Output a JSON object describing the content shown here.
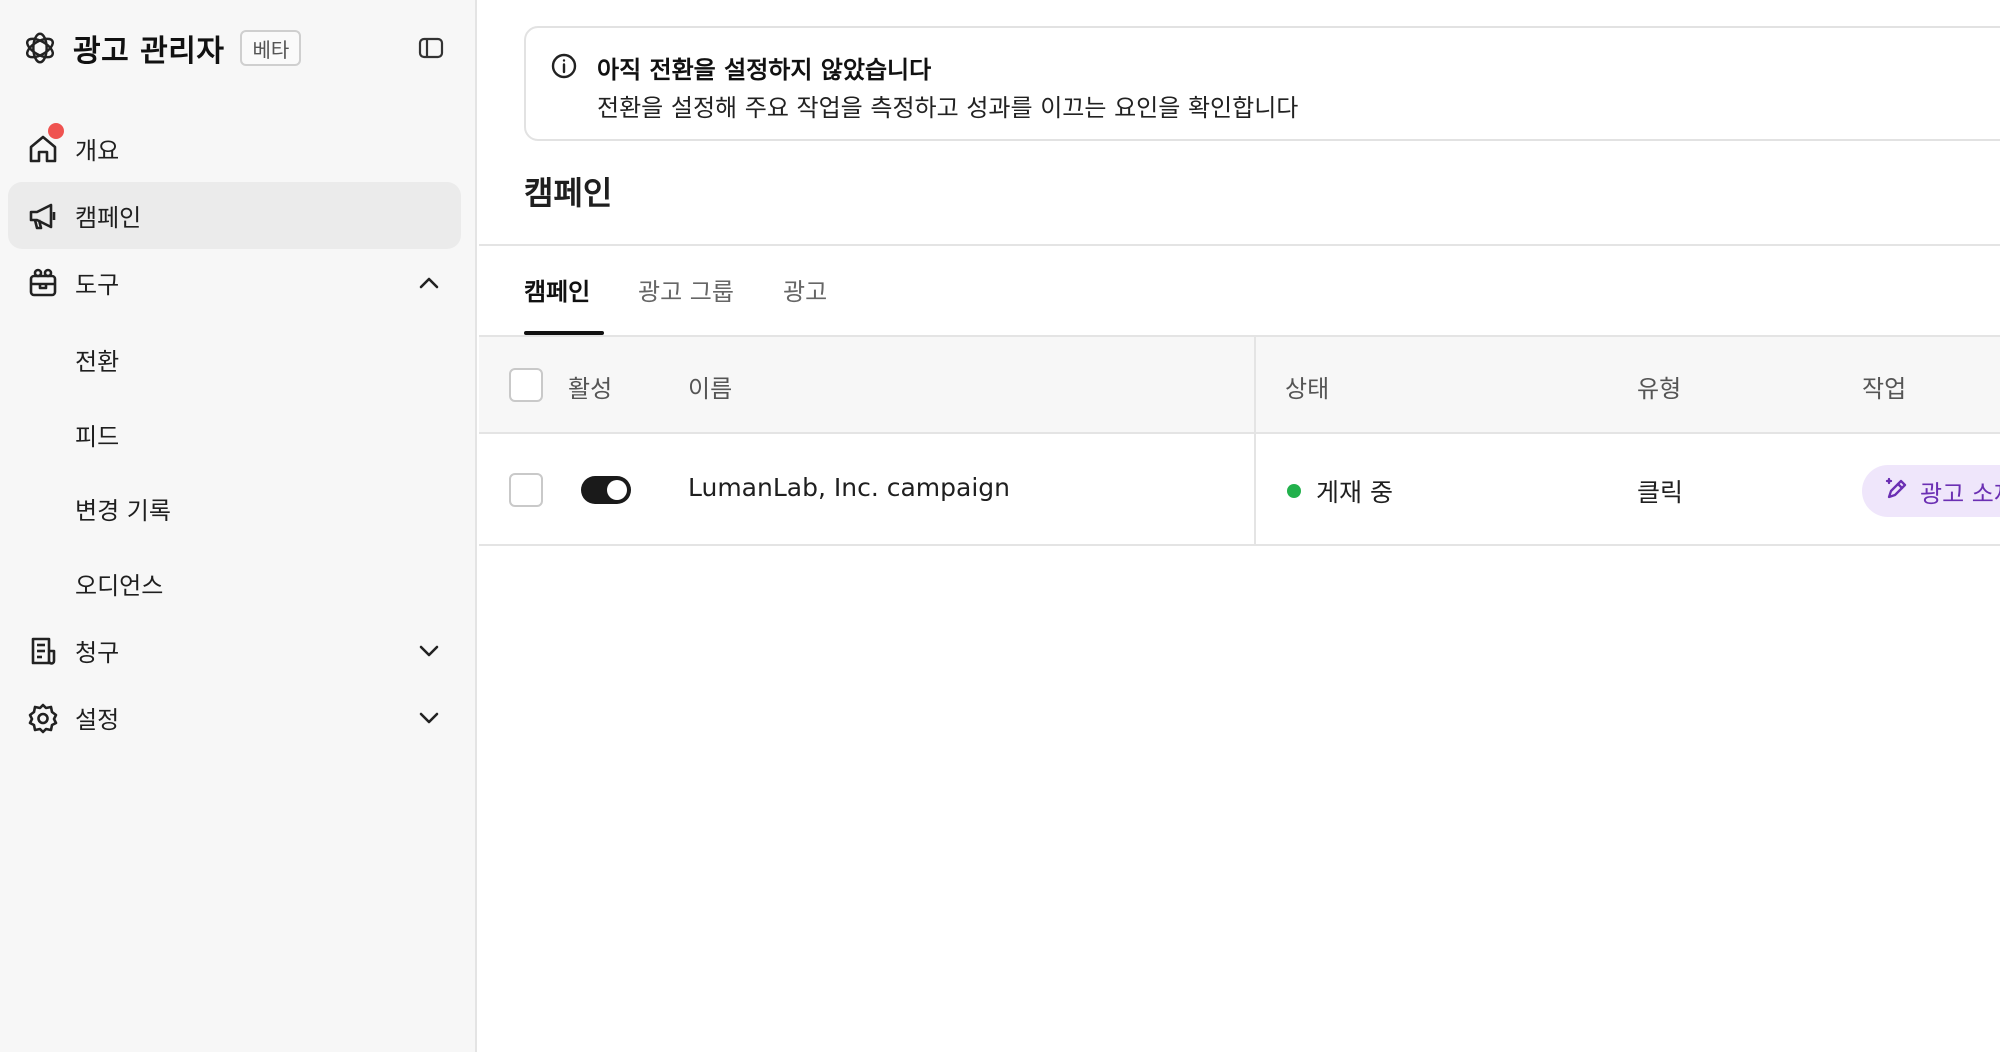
{
  "app": {
    "title": "광고 관리자",
    "badge": "베타"
  },
  "sidebar": {
    "items": [
      {
        "label": "개요",
        "icon": "home-icon",
        "notification": true
      },
      {
        "label": "캠페인",
        "icon": "megaphone-icon",
        "active": true
      },
      {
        "label": "도구",
        "icon": "toolbox-icon",
        "expanded": true
      },
      {
        "label": "청구",
        "icon": "receipt-icon",
        "expanded": false
      },
      {
        "label": "설정",
        "icon": "gear-icon",
        "expanded": false
      }
    ],
    "tools_subitems": [
      "전환",
      "피드",
      "변경 기록",
      "오디언스"
    ]
  },
  "banner": {
    "title": "아직 전환을 설정하지 않았습니다",
    "text": "전환을 설정해 주요 작업을 측정하고 성과를 이끄는 요인을 확인합니다"
  },
  "page": {
    "title": "캠페인"
  },
  "tabs": [
    "캠페인",
    "광고 그룹",
    "광고"
  ],
  "table": {
    "columns": [
      "활성",
      "이름",
      "상태",
      "유형",
      "작업"
    ],
    "rows": [
      {
        "active": true,
        "name": "LumanLab, Inc. campaign",
        "status": "게재 중",
        "type": "클릭",
        "action": "광고 소재"
      }
    ]
  },
  "colors": {
    "status_live": "#22b14c",
    "notification": "#ef5350",
    "action_bg": "#efe6fb",
    "action_text": "#6b2fb3"
  }
}
